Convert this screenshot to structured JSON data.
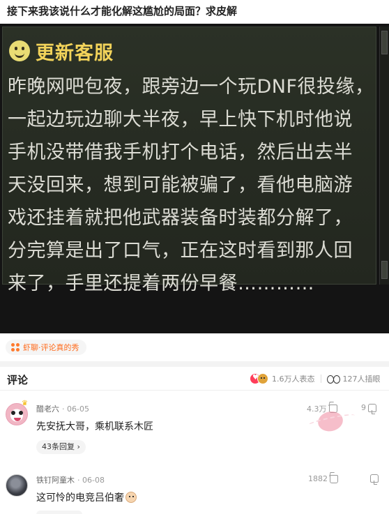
{
  "post": {
    "title": "接下来我该说什么才能化解这尴尬的局面？求皮解"
  },
  "meme": {
    "sender": "更新客服",
    "lines": [
      "昨晚网吧包夜，跟旁边一个玩DNF很投缘，",
      "一起边玩边聊大半夜，早上快下机时他说",
      "手机没带借我手机打个电话，然后出去半",
      "天没回来，想到可能被骗了，看他电脑游",
      "戏还挂着就把他武器装备时装都分解了，",
      "分完算是出了口气，正在这时看到那人回",
      "来了，手里还提着两份早餐…………"
    ]
  },
  "tag": {
    "label": "虾聊·评论真的秀",
    "icon": "grid-dots-icon",
    "color": "#ff6a1a"
  },
  "comments_header": {
    "title": "评论",
    "reactions_text": "1.6万人表态",
    "viewers_text": "127人插眼"
  },
  "comments": [
    {
      "author": "醋老六",
      "date": "· 06-05",
      "likes": "4.3万",
      "dislikes": "9",
      "body": "先安抚大哥，乘机联系木匠",
      "replies": "43条回复 ›"
    },
    {
      "author": "铁钉阿童木",
      "date": "· 06-08",
      "likes": "1882",
      "dislikes": "",
      "body": "这可怜的电竞吕伯奢"
    }
  ]
}
